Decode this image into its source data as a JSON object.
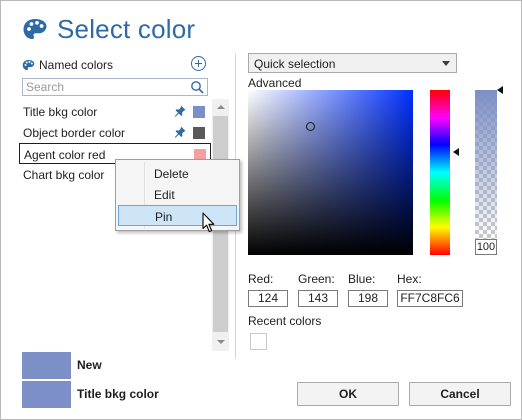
{
  "dialog": {
    "title": "Select color"
  },
  "named_colors": {
    "header": "Named colors",
    "search_placeholder": "Search",
    "items": [
      {
        "label": "Title bkg color",
        "pinned": true,
        "color": "#7b8fc7"
      },
      {
        "label": "Object border color",
        "pinned": true,
        "color": "#595959"
      },
      {
        "label": "Agent color red",
        "pinned": false,
        "color": "#f4a0a0"
      },
      {
        "label": "Chart bkg color",
        "pinned": false,
        "color": ""
      }
    ]
  },
  "context_menu": {
    "items": [
      {
        "label": "Delete"
      },
      {
        "label": "Edit"
      },
      {
        "label": "Pin",
        "hovered": true
      }
    ]
  },
  "picker": {
    "mode": "Quick selection",
    "advanced_label": "Advanced",
    "alpha": "100",
    "fields": {
      "red_label": "Red:",
      "green_label": "Green:",
      "blue_label": "Blue:",
      "hex_label": "Hex:",
      "red": "124",
      "green": "143",
      "blue": "198",
      "hex": "FF7C8FC6"
    },
    "recent_label": "Recent colors"
  },
  "preview": {
    "new_label": "New",
    "new_color": "#7c8fc6",
    "old_label": "Title bkg color",
    "old_color": "#7c8fc6"
  },
  "buttons": {
    "ok": "OK",
    "cancel": "Cancel"
  },
  "colors": {
    "accent": "#2f6aa8",
    "menu_hover": "#cde5f6"
  }
}
